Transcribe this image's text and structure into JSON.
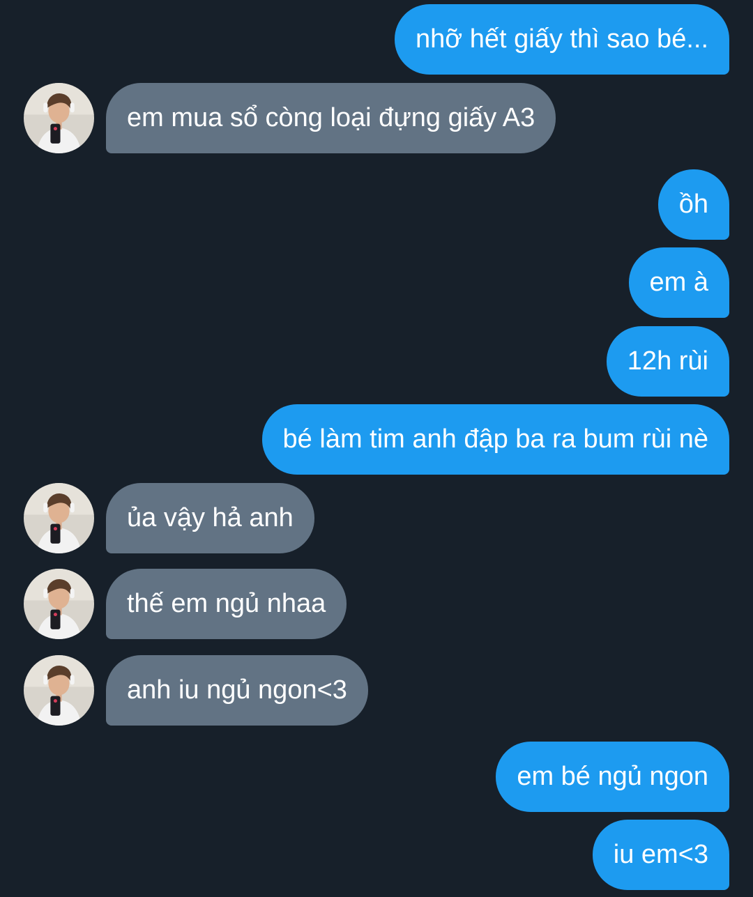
{
  "messages": [
    {
      "side": "out",
      "text": "nhỡ hết giấy thì sao bé..."
    },
    {
      "side": "in",
      "text": "em mua sổ còng loại đựng giấy A3"
    },
    {
      "side": "out",
      "text": "ồh"
    },
    {
      "side": "out",
      "text": "em à"
    },
    {
      "side": "out",
      "text": "12h rùi"
    },
    {
      "side": "out",
      "text": "bé làm tim anh đập ba ra bum rùi nè"
    },
    {
      "side": "in",
      "text": "ủa vậy hả anh"
    },
    {
      "side": "in",
      "text": "thế em ngủ nhaa"
    },
    {
      "side": "in",
      "text": "anh iu ngủ ngon<3"
    },
    {
      "side": "out",
      "text": "em bé ngủ ngon"
    },
    {
      "side": "out",
      "text": "iu em<3"
    }
  ],
  "colors": {
    "background": "#17202a",
    "outgoing_bubble": "#1d9bf0",
    "incoming_bubble": "#627384",
    "text": "#ffffff"
  },
  "icons": {
    "avatar": "profile-photo-avatar"
  }
}
